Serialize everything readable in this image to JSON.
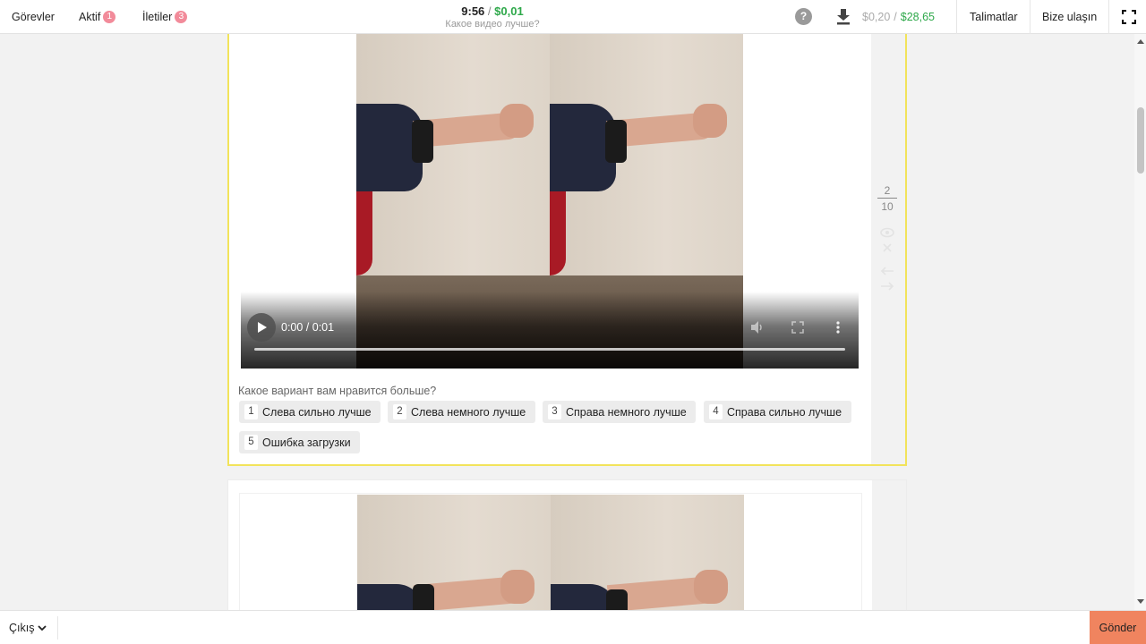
{
  "topbar": {
    "tasks_label": "Görevler",
    "active_label": "Aktif",
    "active_count": "1",
    "messages_label": "İletiler",
    "messages_count": "3",
    "timer": "9:56",
    "separator": "/",
    "reward": "$0,01",
    "task_title": "Какое видео лучше?",
    "help_icon": "?",
    "balance_pending": "$0,20",
    "balance_separator": "/",
    "balance_total": "$28,65",
    "instructions_label": "Talimatlar",
    "contact_label": "Bize ulaşın"
  },
  "colors": {
    "accent_green": "#2ea84a",
    "badge_pink": "#f28b9a",
    "active_card_border": "#f2e35b",
    "send_button": "#f0845f"
  },
  "task": {
    "counter_current": "2",
    "counter_total": "10",
    "video_time": "0:00 / 0:01",
    "question": "Какое вариант вам нравится больше?",
    "options": [
      {
        "key": "1",
        "label": "Слева сильно лучше"
      },
      {
        "key": "2",
        "label": "Слева немного лучше"
      },
      {
        "key": "3",
        "label": "Справа немного лучше"
      },
      {
        "key": "4",
        "label": "Справа сильно лучше"
      },
      {
        "key": "5",
        "label": "Ошибка загрузки"
      }
    ]
  },
  "side_icons": [
    "eye-icon",
    "close-icon",
    "arrow-left-icon",
    "arrow-right-icon"
  ],
  "bottombar": {
    "exit_label": "Çıkış",
    "send_label": "Gönder"
  }
}
